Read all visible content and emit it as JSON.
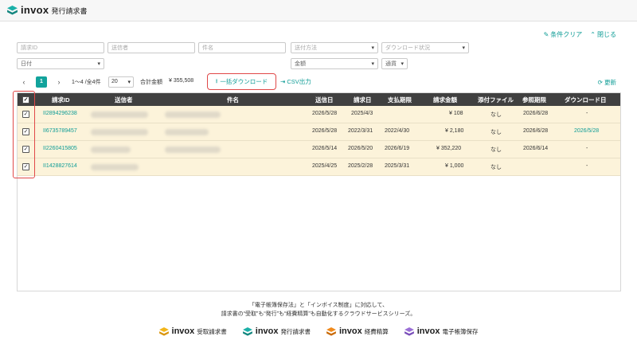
{
  "app": {
    "brand": "invox",
    "product": "発行請求書"
  },
  "toplinks": {
    "clear": "条件クリア",
    "close": "閉じる"
  },
  "filters": {
    "invoice_id": "請求ID",
    "sender": "送信者",
    "subject": "件名",
    "delivery_method": "送付方法",
    "download_status": "ダウンロード状況",
    "date": "日付",
    "amount": "金額",
    "currency": "通貨"
  },
  "pager": {
    "page": "1",
    "range": "1〜4 /全4件",
    "per_page": "20",
    "total_label": "合計金額",
    "total_value": "¥ 355,508"
  },
  "actions": {
    "bulk_download": "一括ダウンロード",
    "csv_export": "CSV出力",
    "refresh": "更新"
  },
  "table": {
    "columns": [
      "請求ID",
      "送信者",
      "件名",
      "送信日",
      "請求日",
      "支払期限",
      "請求金額",
      "添付ファイル",
      "参照期限",
      "ダウンロード日"
    ],
    "rows": [
      {
        "id": "II2894296238",
        "sent": "2026/5/28",
        "billed": "2025/4/3",
        "due": "",
        "amount": "¥ 108",
        "attach": "なし",
        "ref": "2026/6/28",
        "dl": "-"
      },
      {
        "id": "II6735789457",
        "sent": "2026/5/28",
        "billed": "2022/3/31",
        "due": "2022/4/30",
        "amount": "¥ 2,180",
        "attach": "なし",
        "ref": "2026/6/28",
        "dl": "2026/5/28"
      },
      {
        "id": "II2260415805",
        "sent": "2026/5/14",
        "billed": "2026/5/20",
        "due": "2026/6/19",
        "amount": "¥ 352,220",
        "attach": "なし",
        "ref": "2026/6/14",
        "dl": "-"
      },
      {
        "id": "II1428827614",
        "sent": "2025/4/25",
        "billed": "2025/2/28",
        "due": "2025/3/31",
        "amount": "¥ 1,000",
        "attach": "なし",
        "ref": "",
        "dl": "-"
      }
    ]
  },
  "footer": {
    "line1": "「電子帳簿保存法」と「インボイス制度」に対応して、",
    "line2": "請求書の“受取”も“発行”も“経費精算”も自動化するクラウドサービスシリーズ。"
  },
  "brands": [
    {
      "word": "invox",
      "sub": "受取請求書",
      "color": "#f2b51a"
    },
    {
      "word": "invox",
      "sub": "発行請求書",
      "color": "#1bb0a8"
    },
    {
      "word": "invox",
      "sub": "経費精算",
      "color": "#f08a1c"
    },
    {
      "word": "invox",
      "sub": "電子帳簿保存",
      "color": "#9b6fd6"
    }
  ],
  "colors": {
    "accent": "#0e9c96",
    "header_bg": "#404040",
    "row_bg": "#fcf3da",
    "highlight": "#e04848"
  }
}
